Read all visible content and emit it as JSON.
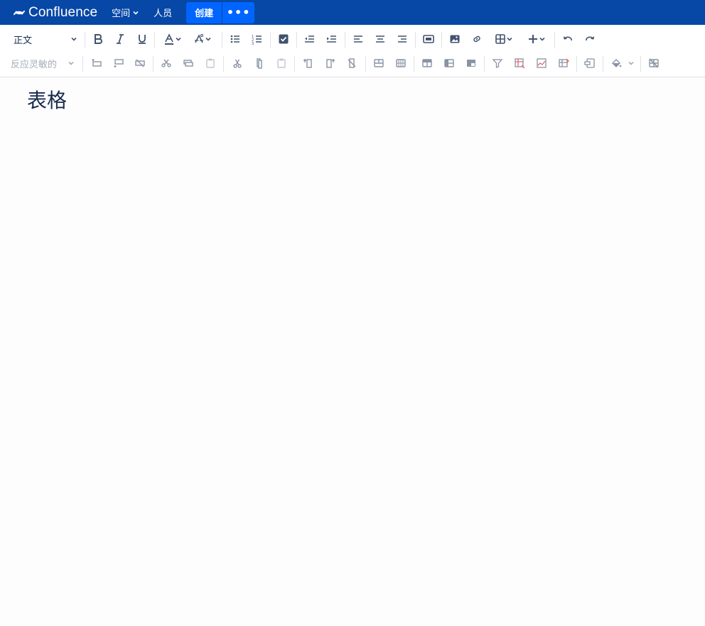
{
  "app": {
    "name": "Confluence"
  },
  "nav": {
    "spaces": "空间",
    "people": "人员",
    "create": "创建",
    "more": "•••"
  },
  "toolbar": {
    "style_select": "正文",
    "table_layout_select": "反应灵敏的"
  },
  "page": {
    "title": "表格"
  }
}
